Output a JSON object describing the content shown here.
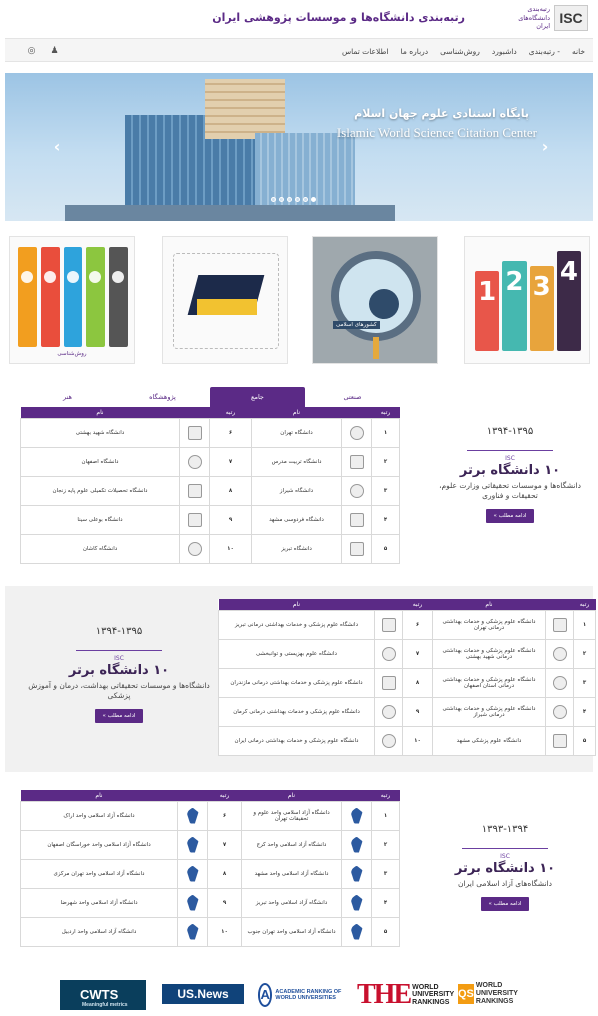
{
  "header": {
    "site_title": "رتبه‌بندی دانشگاه‌ها و موسسات پژوهشی ایران",
    "logo_mark": "ISC",
    "logo_text": "رتبه‌بندی دانشگاه‌های ایران"
  },
  "nav": {
    "items": [
      "خانه",
      "رتبه‌بندی -",
      "داشبورد",
      "روش‌شناسی",
      "درباره ما",
      "اطلاعات تماس"
    ],
    "icons": [
      "globe-icon",
      "user-icon"
    ]
  },
  "slider": {
    "caption_fa": "پایگاه استنادی علوم جهان اسلام",
    "caption_en": "Islamic World Science Citation Center",
    "prev_arrow": "‹",
    "next_arrow": "›",
    "dots": 6,
    "active_dot": 5
  },
  "thumbs": {
    "t1_caption": "روش‌شناسی",
    "t3_label": "کشورهای اسلامی",
    "books": [
      "1",
      "2",
      "3",
      "4"
    ]
  },
  "section1": {
    "tabs": [
      "صنعتی",
      "جامع",
      "پژوهشگاه",
      "هنر"
    ],
    "active_tab": 1,
    "headers": {
      "rank": "رتبه",
      "name": "نام"
    },
    "rows": [
      {
        "rank": "۱",
        "name": "دانشگاه تهران",
        "rank2": "۶",
        "name2": "دانشگاه شهید بهشتی"
      },
      {
        "rank": "۲",
        "name": "دانشگاه تربیت مدرس",
        "rank2": "۷",
        "name2": "دانشگاه اصفهان"
      },
      {
        "rank": "۳",
        "name": "دانشگاه شیراز",
        "rank2": "۸",
        "name2": "دانشگاه تحصیلات تکمیلی علوم پایه زنجان"
      },
      {
        "rank": "۴",
        "name": "دانشگاه فردوسی مشهد",
        "rank2": "۹",
        "name2": "دانشگاه بوعلی سینا"
      },
      {
        "rank": "۵",
        "name": "دانشگاه تبریز",
        "rank2": "۱۰",
        "name2": "دانشگاه کاشان"
      }
    ],
    "promo": {
      "years": "۱۳۹۴-۱۳۹۵",
      "isc": "ISC",
      "heading": "۱۰ دانشگاه برتر",
      "sub": "دانشگاه‌ها و موسسات تحقیقاتی وزارت علوم، تحقیقات و فناوری",
      "button": "ادامه مطلب »"
    }
  },
  "section2": {
    "headers": {
      "rank": "رتبه",
      "name": "نام"
    },
    "rows": [
      {
        "rank": "۱",
        "name": "دانشگاه علوم پزشکی و خدمات بهداشتی درمانی تهران",
        "rank2": "۶",
        "name2": "دانشگاه علوم پزشکی و خدمات بهداشتی درمانی تبریز"
      },
      {
        "rank": "۲",
        "name": "دانشگاه علوم پزشکی و خدمات بهداشتی درمانی شهید بهشتی",
        "rank2": "۷",
        "name2": "دانشگاه علوم بهزیستی و توانبخشی"
      },
      {
        "rank": "۳",
        "name": "دانشگاه علوم پزشکی و خدمات بهداشتی درمانی استان اصفهان",
        "rank2": "۸",
        "name2": "دانشگاه علوم پزشکی و خدمات بهداشتی درمانی مازندران"
      },
      {
        "rank": "۴",
        "name": "دانشگاه علوم پزشکی و خدمات بهداشتی درمانی شیراز",
        "rank2": "۹",
        "name2": "دانشگاه علوم پزشکی و خدمات بهداشتی درمانی کرمان"
      },
      {
        "rank": "۵",
        "name": "دانشگاه علوم پزشکی مشهد",
        "rank2": "۱۰",
        "name2": "دانشگاه علوم پزشکی و خدمات بهداشتی درمانی ایران"
      }
    ],
    "promo": {
      "years": "۱۳۹۴-۱۳۹۵",
      "isc": "ISC",
      "heading": "۱۰ دانشگاه برتر",
      "sub": "دانشگاه‌ها و موسسات تحقیقاتی بهداشت، درمان و آموزش پزشکی",
      "button": "ادامه مطلب »"
    }
  },
  "section3": {
    "headers": {
      "rank": "رتبه",
      "name": "نام"
    },
    "rows": [
      {
        "rank": "۱",
        "name": "دانشگاه آزاد اسلامی واحد علوم و تحقیقات تهران",
        "rank2": "۶",
        "name2": "دانشگاه آزاد اسلامی واحد اراک"
      },
      {
        "rank": "۲",
        "name": "دانشگاه آزاد اسلامی واحد کرج",
        "rank2": "۷",
        "name2": "دانشگاه آزاد اسلامی واحد خوراسگان اصفهان"
      },
      {
        "rank": "۳",
        "name": "دانشگاه آزاد اسلامی واحد مشهد",
        "rank2": "۸",
        "name2": "دانشگاه آزاد اسلامی واحد تهران مرکزی"
      },
      {
        "rank": "۴",
        "name": "دانشگاه آزاد اسلامی واحد تبریز",
        "rank2": "۹",
        "name2": "دانشگاه آزاد اسلامی واحد شهرضا"
      },
      {
        "rank": "۵",
        "name": "دانشگاه آزاد اسلامی واحد تهران جنوب",
        "rank2": "۱۰",
        "name2": "دانشگاه آزاد اسلامی واحد اردبیل"
      }
    ],
    "promo": {
      "years": "۱۳۹۳-۱۳۹۴",
      "isc": "ISC",
      "heading": "۱۰ دانشگاه برتر",
      "sub": "دانشگاه‌های آزاد اسلامی ایران",
      "button": "ادامه مطلب »"
    }
  },
  "partners": {
    "cwts": "CWTS",
    "cwts_tag": "Meaningful metrics",
    "usnews": "US.News",
    "arwu_a": "A",
    "arwu_text": "ACADEMIC RANKING OF WORLD UNIVERSITIES",
    "the_big": "THE",
    "the_small": "WORLD UNIVERSITY RANKINGS",
    "qs_mark": "QS",
    "qs_text": "WORLD UNIVERSITY RANKINGS"
  },
  "colors": {
    "accent": "#5b2a86",
    "section_bg": "#f1f1f1"
  }
}
